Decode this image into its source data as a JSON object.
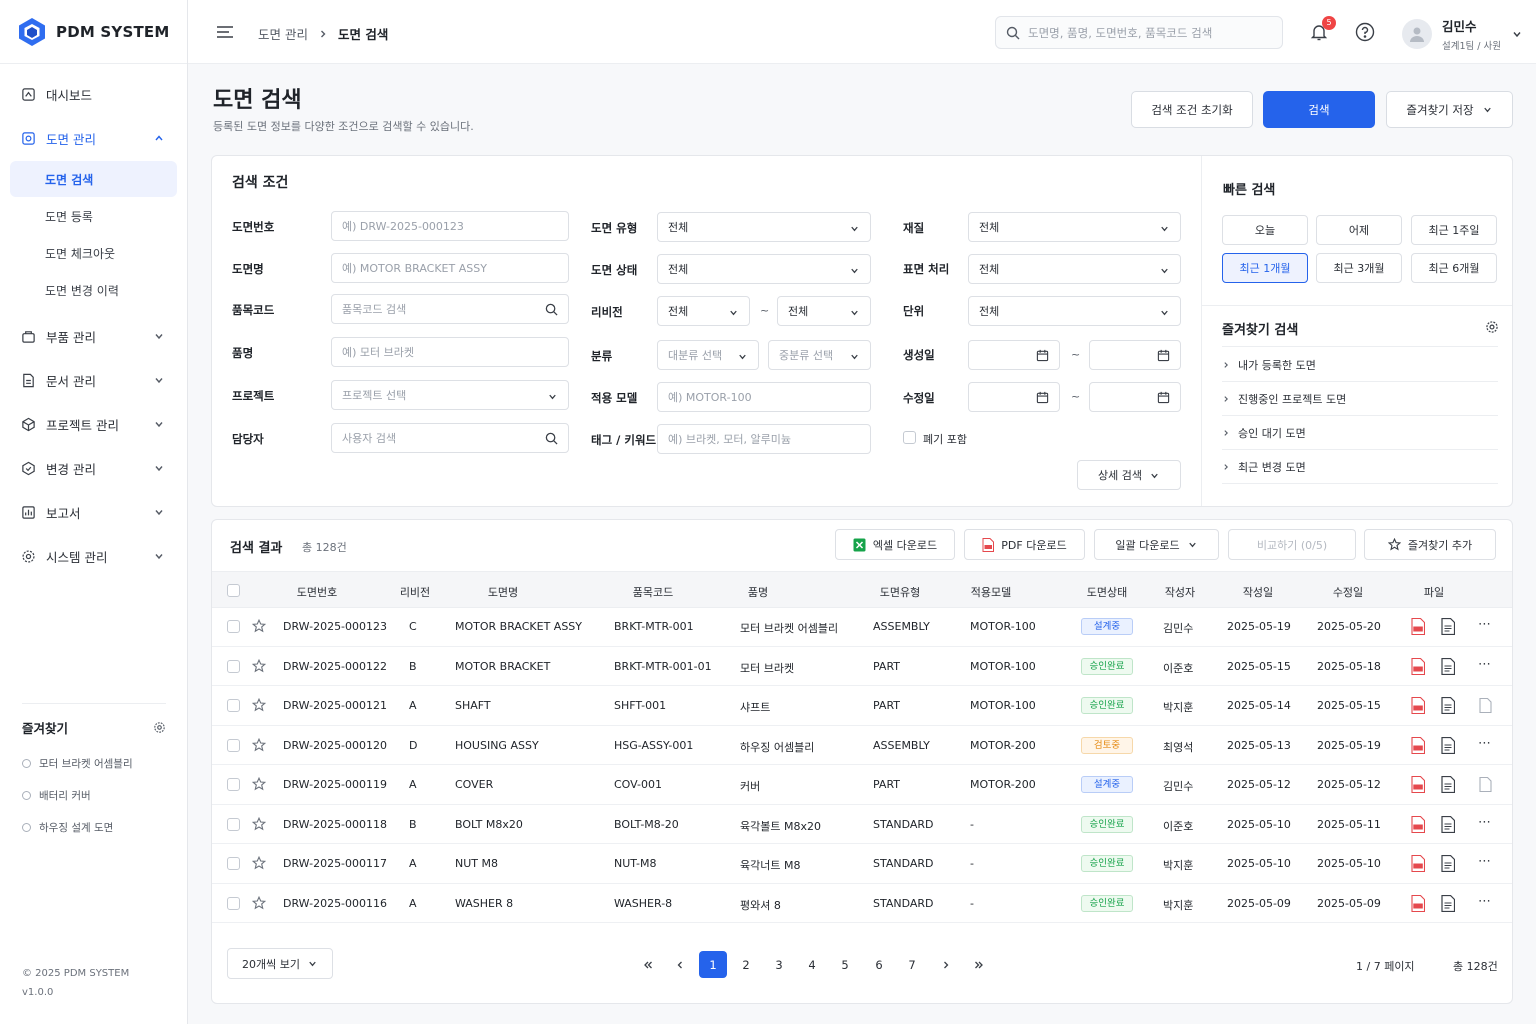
{
  "app": {
    "name": "PDM SYSTEM",
    "copyright": "© 2025 PDM SYSTEM",
    "version": "v1.0.0"
  },
  "nav": [
    {
      "label": "대시보드",
      "icon": "home-icon"
    },
    {
      "label": "도면 관리",
      "icon": "drawing-icon",
      "expanded": true,
      "children": [
        "도면 검색",
        "도면 등록",
        "도면 체크아웃",
        "도면 변경 이력"
      ]
    },
    {
      "label": "부품 관리",
      "icon": "parts-icon"
    },
    {
      "label": "문서 관리",
      "icon": "document-icon"
    },
    {
      "label": "프로젝트 관리",
      "icon": "project-icon"
    },
    {
      "label": "변경 관리",
      "icon": "change-icon"
    },
    {
      "label": "보고서",
      "icon": "report-icon"
    },
    {
      "label": "시스템 관리",
      "icon": "settings-icon"
    }
  ],
  "sidebar_favorites": {
    "title": "즐겨찾기",
    "items": [
      "모터 브라켓 어셈블리",
      "배터리 커버",
      "하우징 설계 도면"
    ]
  },
  "topbar": {
    "breadcrumb": [
      "도면 관리",
      "도면 검색"
    ],
    "search_placeholder": "도면명, 품명, 도면번호, 품목코드 검색",
    "notifications": "5",
    "user_name": "김민수",
    "user_role": "설계1팀 / 사원"
  },
  "page": {
    "title": "도면 검색",
    "subtitle": "등록된 도면 정보를 다양한 조건으로 검색할 수 있습니다.",
    "reset": "검색 조건 초기화",
    "search": "검색",
    "save_fav": "즐겨찾기 저장"
  },
  "filters": {
    "title": "검색 조건",
    "drawing_no": {
      "label": "도면번호",
      "placeholder": "예) DRW-2025-000123"
    },
    "drawing_name": {
      "label": "도면명",
      "placeholder": "예) MOTOR BRACKET ASSY"
    },
    "item_code": {
      "label": "품목코드",
      "placeholder": "품목코드 검색"
    },
    "item_name": {
      "label": "품명",
      "placeholder": "예) 모터 브라켓"
    },
    "project": {
      "label": "프로젝트",
      "placeholder": "프로젝트 선택"
    },
    "owner": {
      "label": "담당자",
      "placeholder": "사용자 검색"
    },
    "type": {
      "label": "도면 유형",
      "value": "전체"
    },
    "status": {
      "label": "도면 상태",
      "value": "전체"
    },
    "revision": {
      "label": "리비전",
      "from": "전체",
      "to": "전체"
    },
    "category": {
      "label": "분류",
      "major": "대분류 선택",
      "middle": "중분류 선택"
    },
    "model": {
      "label": "적용 모델",
      "placeholder": "예) MOTOR-100"
    },
    "tags": {
      "label": "태그 / 키워드",
      "placeholder": "예) 브라켓, 모터, 알루미늄"
    },
    "material": {
      "label": "재질",
      "value": "전체"
    },
    "surface": {
      "label": "표면 처리",
      "value": "전체"
    },
    "unit": {
      "label": "단위",
      "value": "전체"
    },
    "created": {
      "label": "생성일"
    },
    "modified": {
      "label": "수정일"
    },
    "include_obsolete": "폐기 포함",
    "advanced": "상세 검색",
    "tilde": "~"
  },
  "quick": {
    "title": "빠른 검색",
    "buttons": [
      "오늘",
      "어제",
      "최근 1주일",
      "최근 1개월",
      "최근 3개월",
      "최근 6개월"
    ],
    "selected": "최근 1개월"
  },
  "fav_search": {
    "title": "즐겨찾기 검색",
    "items": [
      "내가 등록한 도면",
      "진행중인 프로젝트 도면",
      "승인 대기 도면",
      "최근 변경 도면"
    ]
  },
  "results": {
    "title": "검색 결과",
    "count": "총 128건",
    "excel": "엑셀 다운로드",
    "pdf": "PDF 다운로드",
    "bulk": "일괄 다운로드",
    "compare": "비교하기 (0/5)",
    "add_fav": "즐겨찾기 추가",
    "columns": [
      "도면번호",
      "리비전",
      "도면명",
      "품목코드",
      "품명",
      "도면유형",
      "적용모델",
      "도면상태",
      "작성자",
      "작성일",
      "수정일",
      "파일"
    ],
    "rows": [
      {
        "no": "DRW-2025-000123",
        "rev": "C",
        "name": "MOTOR BRACKET ASSY",
        "code": "BRKT-MTR-001",
        "item": "모터 브라켓 어셈블리",
        "type": "ASSEMBLY",
        "model": "MOTOR-100",
        "status": "설계중",
        "status_color": "blue",
        "author": "김민수",
        "created": "2025-05-19",
        "modified": "2025-05-20",
        "extra": "more"
      },
      {
        "no": "DRW-2025-000122",
        "rev": "B",
        "name": "MOTOR BRACKET",
        "code": "BRKT-MTR-001-01",
        "item": "모터 브라켓",
        "type": "PART",
        "model": "MOTOR-100",
        "status": "승인완료",
        "status_color": "green",
        "author": "이준호",
        "created": "2025-05-15",
        "modified": "2025-05-18",
        "extra": "more"
      },
      {
        "no": "DRW-2025-000121",
        "rev": "A",
        "name": "SHAFT",
        "code": "SHFT-001",
        "item": "샤프트",
        "type": "PART",
        "model": "MOTOR-100",
        "status": "승인완료",
        "status_color": "green",
        "author": "박지훈",
        "created": "2025-05-14",
        "modified": "2025-05-15",
        "extra": "file"
      },
      {
        "no": "DRW-2025-000120",
        "rev": "D",
        "name": "HOUSING ASSY",
        "code": "HSG-ASSY-001",
        "item": "하우징 어셈블리",
        "type": "ASSEMBLY",
        "model": "MOTOR-200",
        "status": "검토중",
        "status_color": "orange",
        "author": "최영석",
        "created": "2025-05-13",
        "modified": "2025-05-19",
        "extra": "more"
      },
      {
        "no": "DRW-2025-000119",
        "rev": "A",
        "name": "COVER",
        "code": "COV-001",
        "item": "커버",
        "type": "PART",
        "model": "MOTOR-200",
        "status": "설계중",
        "status_color": "blue",
        "author": "김민수",
        "created": "2025-05-12",
        "modified": "2025-05-12",
        "extra": "file"
      },
      {
        "no": "DRW-2025-000118",
        "rev": "B",
        "name": "BOLT M8x20",
        "code": "BOLT-M8-20",
        "item": "육각볼트 M8x20",
        "type": "STANDARD",
        "model": "-",
        "status": "승인완료",
        "status_color": "green",
        "author": "이준호",
        "created": "2025-05-10",
        "modified": "2025-05-11",
        "extra": "more"
      },
      {
        "no": "DRW-2025-000117",
        "rev": "A",
        "name": "NUT M8",
        "code": "NUT-M8",
        "item": "육각너트 M8",
        "type": "STANDARD",
        "model": "-",
        "status": "승인완료",
        "status_color": "green",
        "author": "박지훈",
        "created": "2025-05-10",
        "modified": "2025-05-10",
        "extra": "more"
      },
      {
        "no": "DRW-2025-000116",
        "rev": "A",
        "name": "WASHER 8",
        "code": "WASHER-8",
        "item": "평와셔 8",
        "type": "STANDARD",
        "model": "-",
        "status": "승인완료",
        "status_color": "green",
        "author": "박지훈",
        "created": "2025-05-09",
        "modified": "2025-05-09",
        "extra": "more"
      }
    ]
  },
  "pagination": {
    "page_size": "20개씩 보기",
    "pages": [
      "1",
      "2",
      "3",
      "4",
      "5",
      "6",
      "7"
    ],
    "current": "1",
    "page_info": "1 / 7 페이지",
    "total": "총 128건"
  },
  "colors": {
    "accent": "#2563eb",
    "status_blue": "#2563eb",
    "status_green": "#16a34a",
    "status_orange": "#e58a12",
    "pdf_red": "#e5484d",
    "excel_green": "#16a34a"
  }
}
